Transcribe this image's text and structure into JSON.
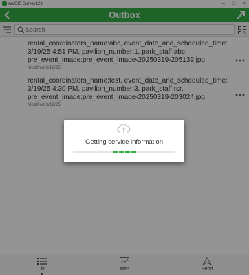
{
  "window": {
    "title": "ArcGIS Survey123"
  },
  "header": {
    "title": "Outbox"
  },
  "search": {
    "placeholder": "Search"
  },
  "items": [
    {
      "line1": "rental_coordinators_name:abc, event_date_and_scheduled_time:",
      "line2": "3/19/25 4:51 PM, pavilion_number:1, park_staff:abc,",
      "line3": "pre_event_image:pre_event_image-20250319-205139.jpg",
      "modified": "Modified 3/19/25"
    },
    {
      "line1": "rental_coordinators_name:test, event_date_and_scheduled_time:",
      "line2": "3/19/25 4:30 PM, pavilion_number:3, park_staff:rsr,",
      "line3": "pre_event_image:pre_event_image-20250319-203024.jpg",
      "modified": "Modified 3/19/25"
    }
  ],
  "dialog": {
    "message": "Getting service information"
  },
  "bottom_tabs": [
    {
      "label": "List",
      "icon": "list-icon",
      "active": true
    },
    {
      "label": "Map",
      "icon": "map-icon",
      "active": false
    },
    {
      "label": "Send",
      "icon": "send-icon",
      "active": false
    }
  ],
  "colors": {
    "accent": "#35ac46",
    "overlay": "rgba(0,0,0,0.42)"
  }
}
